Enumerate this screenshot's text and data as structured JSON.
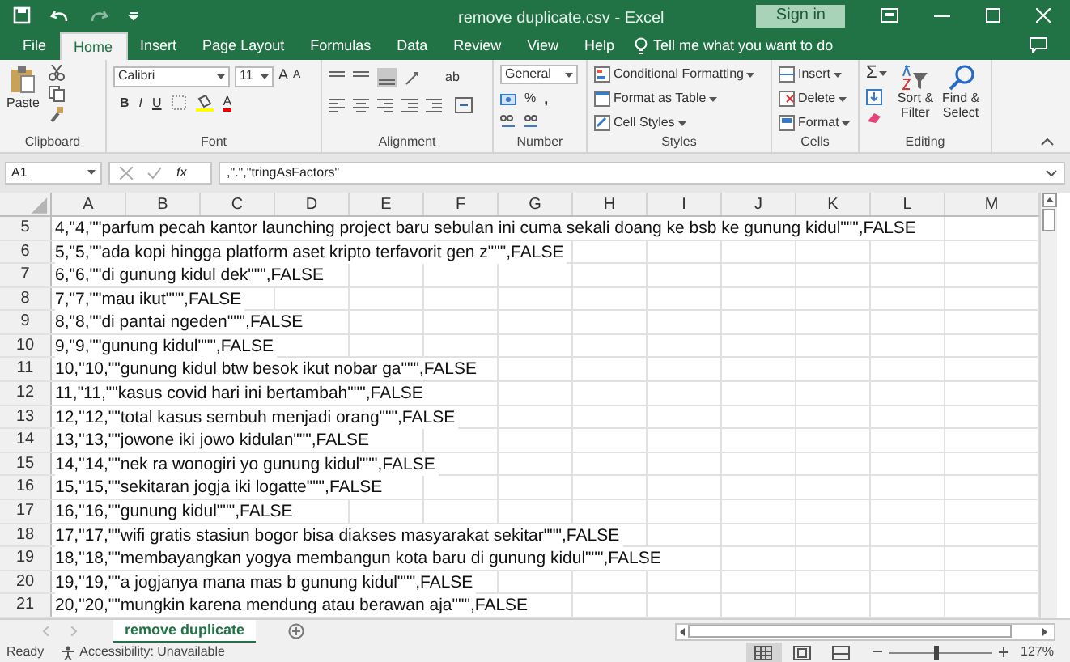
{
  "window": {
    "title": "remove duplicate.csv  -  Excel",
    "sign_in": "Sign in"
  },
  "menu_tabs": [
    {
      "label": "File",
      "selected": false
    },
    {
      "label": "Home",
      "selected": true
    },
    {
      "label": "Insert",
      "selected": false
    },
    {
      "label": "Page Layout",
      "selected": false
    },
    {
      "label": "Formulas",
      "selected": false
    },
    {
      "label": "Data",
      "selected": false
    },
    {
      "label": "Review",
      "selected": false
    },
    {
      "label": "View",
      "selected": false
    },
    {
      "label": "Help",
      "selected": false
    }
  ],
  "tell_me": "Tell me what you want to do",
  "ribbon": {
    "clipboard": {
      "paste": "Paste",
      "label": "Clipboard"
    },
    "font": {
      "name": "Calibri",
      "size": "11",
      "grow": "A",
      "shrink": "A",
      "bold": "B",
      "italic": "I",
      "underline": "U",
      "font_color_letter": "A",
      "label": "Font"
    },
    "alignment": {
      "wrap": "ab",
      "label": "Alignment"
    },
    "number": {
      "format": "General",
      "percent": "%",
      "comma": ",",
      "label": "Number"
    },
    "styles": {
      "items": [
        "Conditional Formatting",
        "Format as Table",
        "Cell Styles"
      ],
      "label": "Styles"
    },
    "cells": {
      "items": [
        "Insert",
        "Delete",
        "Format"
      ],
      "label": "Cells"
    },
    "editing": {
      "sum": "Σ",
      "sort": "Sort & Filter",
      "find": "Find & Select",
      "label": "Editing"
    }
  },
  "formula_bar": {
    "name_box": "A1",
    "fx": "fx",
    "formula": ",\".\",\"tringAsFactors\""
  },
  "columns": [
    "A",
    "B",
    "C",
    "D",
    "E",
    "F",
    "G",
    "H",
    "I",
    "J",
    "K",
    "L",
    "M"
  ],
  "rows": [
    {
      "number": "5",
      "text": "4,\"4,\"\"parfum pecah kantor launching project baru sebulan ini cuma sekali doang ke bsb ke gunung kidul\"\"\",FALSE"
    },
    {
      "number": "6",
      "text": "5,\"5,\"\"ada kopi hingga platform aset kripto terfavorit gen z\"\"\",FALSE"
    },
    {
      "number": "7",
      "text": "6,\"6,\"\"di gunung kidul dek\"\"\",FALSE"
    },
    {
      "number": "8",
      "text": "7,\"7,\"\"mau ikut\"\"\",FALSE"
    },
    {
      "number": "9",
      "text": "8,\"8,\"\"di pantai ngeden\"\"\",FALSE"
    },
    {
      "number": "10",
      "text": "9,\"9,\"\"gunung kidul\"\"\",FALSE"
    },
    {
      "number": "11",
      "text": "10,\"10,\"\"gunung kidul btw besok ikut nobar ga\"\"\",FALSE"
    },
    {
      "number": "12",
      "text": "11,\"11,\"\"kasus covid hari ini bertambah\"\"\",FALSE"
    },
    {
      "number": "13",
      "text": "12,\"12,\"\"total kasus sembuh menjadi orang\"\"\",FALSE"
    },
    {
      "number": "14",
      "text": "13,\"13,\"\"jowone iki jowo kidulan\"\"\",FALSE"
    },
    {
      "number": "15",
      "text": "14,\"14,\"\"nek ra wonogiri yo gunung kidul\"\"\",FALSE"
    },
    {
      "number": "16",
      "text": "15,\"15,\"\"sekitaran jogja iki logatte\"\"\",FALSE"
    },
    {
      "number": "17",
      "text": "16,\"16,\"\"gunung kidul\"\"\",FALSE"
    },
    {
      "number": "18",
      "text": "17,\"17,\"\"wifi gratis stasiun bogor bisa diakses masyarakat sekitar\"\"\",FALSE"
    },
    {
      "number": "19",
      "text": "18,\"18,\"\"membayangkan yogya membangun kota baru di gunung kidul\"\"\",FALSE"
    },
    {
      "number": "20",
      "text": "19,\"19,\"\"a jogjanya mana mas b gunung kidul\"\"\",FALSE"
    },
    {
      "number": "21",
      "text": "20,\"20,\"\"mungkin karena mendung atau berawan aja\"\"\",FALSE"
    }
  ],
  "sheet_tabs": [
    {
      "label": "remove duplicate",
      "selected": true
    }
  ],
  "status_bar": {
    "ready": "Ready",
    "accessibility": "Accessibility: Unavailable",
    "views": [
      {
        "kind": "normal",
        "selected": true
      },
      {
        "kind": "page_layout",
        "selected": false
      },
      {
        "kind": "page_break",
        "selected": false
      }
    ],
    "zoom": {
      "level": 0.47,
      "text": "127%"
    }
  }
}
